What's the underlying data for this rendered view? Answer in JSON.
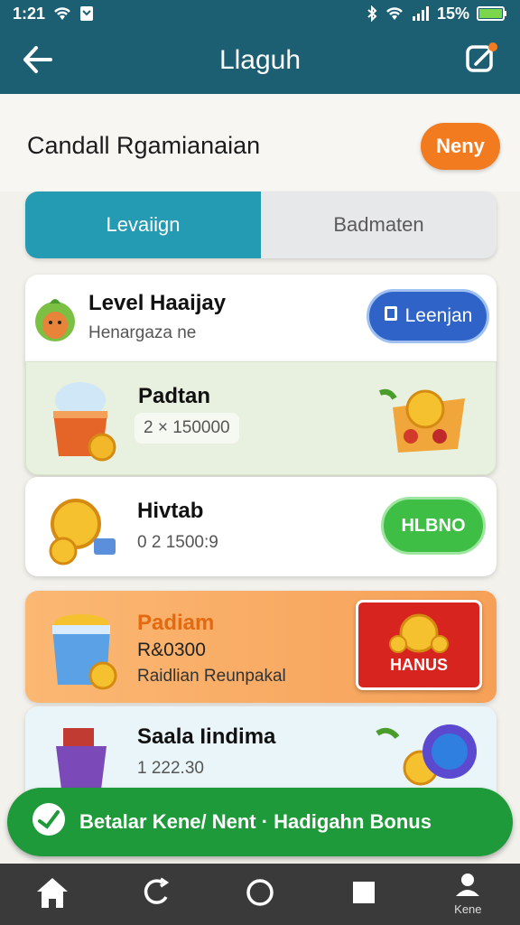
{
  "status_bar": {
    "time": "1:21",
    "battery": "15%"
  },
  "app_bar": {
    "title": "Llaguh"
  },
  "header": {
    "title": "Candall Rgamianaian",
    "new_button": "Neny"
  },
  "tabs": [
    {
      "label": "Levaiign",
      "active": true
    },
    {
      "label": "Badmaten",
      "active": false
    }
  ],
  "cards": [
    {
      "title": "Level Haaijay",
      "subtitle": "Henargaza ne",
      "button": "Leenjan"
    },
    {
      "title": "Padtan",
      "value": "2 × 150000"
    },
    {
      "title": "Hivtab",
      "value": "0 2 1500:9",
      "button": "HLBNO"
    },
    {
      "title": "Padiam",
      "amount": "R&0300",
      "subtitle": "Raidlian Reunpakal",
      "button": "HANUS"
    },
    {
      "title": "Saala Iindima",
      "value": "1 222.30"
    }
  ],
  "action_bar": {
    "label": "Betalar Kene/ Nent · Hadigahn Bonus"
  },
  "bottom_nav": [
    {
      "icon": "home-icon",
      "label": ""
    },
    {
      "icon": "refresh-icon",
      "label": ""
    },
    {
      "icon": "circle-icon",
      "label": ""
    },
    {
      "icon": "square-icon",
      "label": ""
    },
    {
      "icon": "profile-icon",
      "label": "Kene"
    }
  ],
  "colors": {
    "appbar": "#1d5f72",
    "accent_orange": "#f37b1f",
    "tab_active": "#259ab3",
    "blue_button": "#2f63c7",
    "green_button": "#3fbe46",
    "red_button": "#d8241f",
    "action_green": "#1f9a3a"
  }
}
